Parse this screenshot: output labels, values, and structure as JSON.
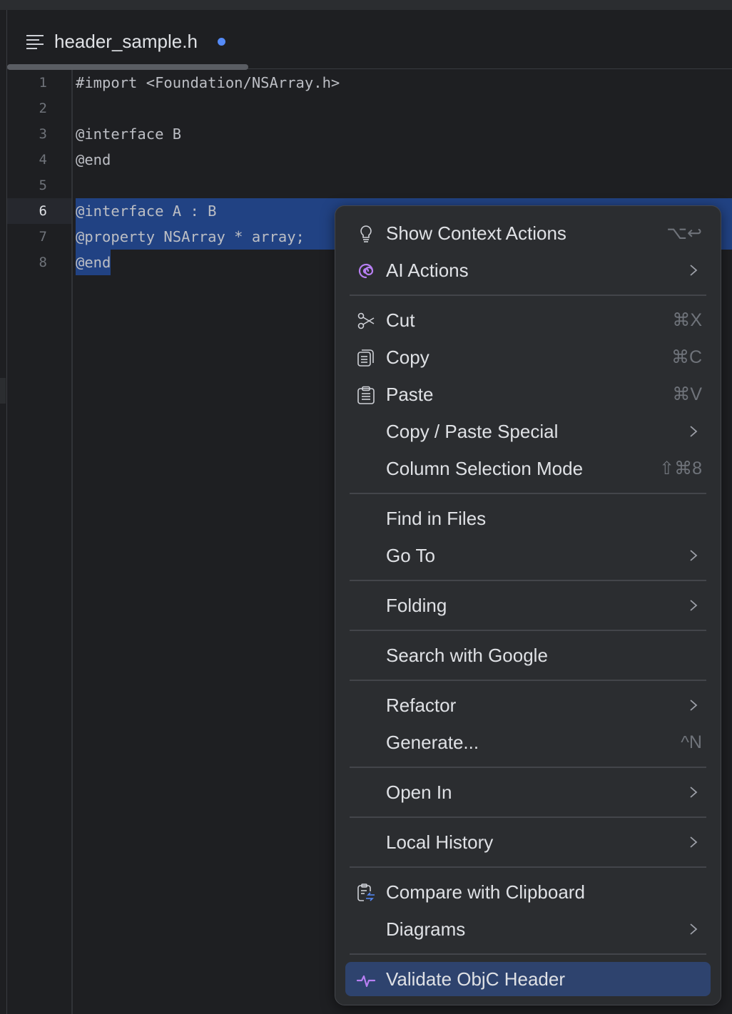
{
  "tab": {
    "file_name": "header_sample.h",
    "modified": true,
    "icon": "text-file-icon",
    "modified_color": "#548af7"
  },
  "editor": {
    "current_line": 6,
    "selection_color": "#214283",
    "lines": [
      {
        "n": "1",
        "text": "#import <Foundation/NSArray.h>"
      },
      {
        "n": "2",
        "text": ""
      },
      {
        "n": "3",
        "text": "@interface B"
      },
      {
        "n": "4",
        "text": "@end"
      },
      {
        "n": "5",
        "text": ""
      },
      {
        "n": "6",
        "text": "@interface A : B"
      },
      {
        "n": "7",
        "text": "@property NSArray * array;"
      },
      {
        "n": "8",
        "text": "@end"
      }
    ]
  },
  "context_menu": {
    "items": [
      {
        "label": "Show Context Actions",
        "icon": "lightbulb-icon",
        "shortcut": "⌥↩"
      },
      {
        "label": "AI Actions",
        "icon": "ai-spiral-icon",
        "submenu": true
      },
      {
        "label": "Cut",
        "icon": "scissors-icon",
        "shortcut": "⌘X"
      },
      {
        "label": "Copy",
        "icon": "copy-icon",
        "shortcut": "⌘C"
      },
      {
        "label": "Paste",
        "icon": "clipboard-icon",
        "shortcut": "⌘V"
      },
      {
        "label": "Copy / Paste Special",
        "submenu": true
      },
      {
        "label": "Column Selection Mode",
        "shortcut": "⇧⌘8"
      },
      {
        "label": "Find in Files"
      },
      {
        "label": "Go To",
        "submenu": true
      },
      {
        "label": "Folding",
        "submenu": true
      },
      {
        "label": "Search with Google"
      },
      {
        "label": "Refactor",
        "submenu": true
      },
      {
        "label": "Generate...",
        "shortcut": "^N"
      },
      {
        "label": "Open In",
        "submenu": true
      },
      {
        "label": "Local History",
        "submenu": true
      },
      {
        "label": "Compare with Clipboard",
        "icon": "compare-clipboard-icon"
      },
      {
        "label": "Diagrams",
        "submenu": true
      },
      {
        "label": "Validate ObjC Header",
        "icon": "pulse-icon",
        "highlighted": true
      }
    ]
  }
}
